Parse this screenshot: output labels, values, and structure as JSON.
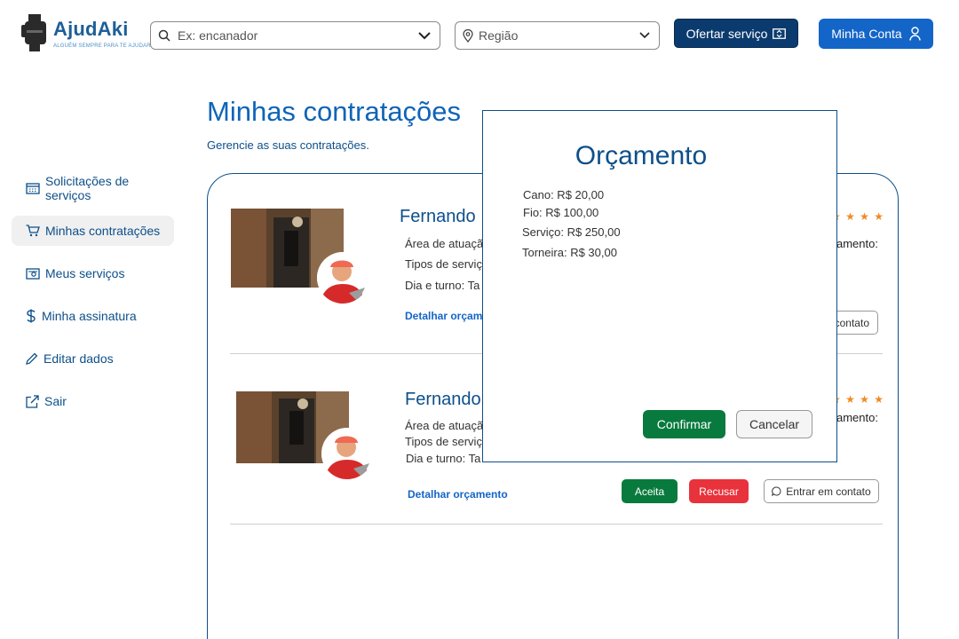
{
  "header": {
    "logo_name": "AjudAki",
    "logo_tagline": "ALGUÉM SEMPRE PARA TE AJUDAR",
    "search_placeholder": "Ex: encanador",
    "region_placeholder": "Região",
    "offer_button": "Ofertar serviço",
    "account_button": "Minha Conta"
  },
  "sidebar": {
    "items": [
      {
        "label": "Solicitações de serviços",
        "icon": "calendar-icon"
      },
      {
        "label": "Minhas contratações",
        "icon": "cart-icon",
        "active": true
      },
      {
        "label": "Meus serviços",
        "icon": "money-icon"
      },
      {
        "label": "Minha assinatura",
        "icon": "dollar-icon"
      },
      {
        "label": "Editar dados",
        "icon": "pencil-icon"
      },
      {
        "label": "Sair",
        "icon": "external-link-icon"
      }
    ]
  },
  "page": {
    "title": "Minhas contratações",
    "subtitle": "Gerencie as suas contratações."
  },
  "cards": [
    {
      "name": "Fernando",
      "area": "Área de atuaçã",
      "types": "Tipos de serviç",
      "day": "Dia e turno: Ta",
      "detail_link": "Detalhar orçam",
      "stars": "★ ★ ★ ★",
      "right_text": "amento:",
      "contact_button": "contato"
    },
    {
      "name": "Fernando",
      "area": "Área de atuaçã",
      "types": "Tipos de serviç",
      "day": "Dia e turno: Ta",
      "detail_link": "Detalhar orçamento",
      "stars": "★ ★ ★ ★",
      "right_text": "amento:",
      "accept_button": "Aceita",
      "refuse_button": "Recusar",
      "contact_button": "Entrar em contato"
    }
  ],
  "modal": {
    "title": "Orçamento",
    "lines": [
      "Cano: R$ 20,00",
      "Fio: R$ 100,00",
      "Serviço: R$ 250,00",
      "Torneira: R$ 30,00"
    ],
    "confirm_button": "Confirmar",
    "cancel_button": "Cancelar"
  },
  "colors": {
    "primary": "#0d4f8a",
    "accent_blue": "#1465c8",
    "dark_blue": "#0b3b6e",
    "accept_green": "#087a3d",
    "refuse_red": "#e8323c",
    "star_orange": "#f08a24"
  }
}
